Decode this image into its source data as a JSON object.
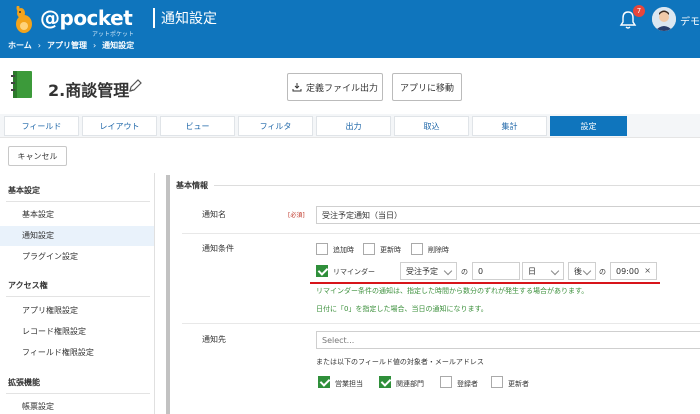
{
  "header": {
    "brand": "@pocket",
    "brand_sub": "アットポケット",
    "page_title": "通知設定",
    "breadcrumbs": [
      "ホーム",
      "アプリ管理",
      "通知設定"
    ],
    "breadcrumb_sep": "›",
    "notification_count": "7",
    "user_name": "デモ"
  },
  "app": {
    "title": "2.商談管理",
    "export_label": "定義ファイル出力",
    "goto_label": "アプリに移動"
  },
  "tabs": [
    "フィールド",
    "レイアウト",
    "ビュー",
    "フィルタ",
    "出力",
    "取込",
    "集計",
    "設定"
  ],
  "active_tab": "設定",
  "cancel_label": "キャンセル",
  "sidebar": {
    "sections": [
      {
        "title": "基本設定",
        "items": [
          "基本設定",
          "通知設定",
          "プラグイン設定"
        ]
      },
      {
        "title": "アクセス権",
        "items": [
          "アプリ権限設定",
          "レコード権限設定",
          "フィールド権限設定"
        ]
      },
      {
        "title": "拡張機能",
        "items": [
          "帳票設定"
        ]
      }
    ],
    "active_item": "通知設定"
  },
  "form": {
    "section_title": "基本情報",
    "name_label": "通知名",
    "required_label": "[必須]",
    "name_value": "受注予定通知（当日）",
    "condition_label": "通知条件",
    "condition_options": [
      {
        "label": "追加時",
        "checked": false
      },
      {
        "label": "更新時",
        "checked": false
      },
      {
        "label": "削除時",
        "checked": false
      }
    ],
    "reminder": {
      "label": "リマインダー",
      "checked": true,
      "field": "受注予定",
      "of1": "の",
      "offset_value": "0",
      "unit": "日",
      "direction": "後",
      "of2": "の",
      "time": "09:00",
      "clear": "×"
    },
    "note_red": "リマインダー条件の通知は、指定した時間から数分のずれが発生する場合があります。",
    "note_green": "日付に「0」を指定した場合、当日の通知になります。",
    "recipient_label": "通知先",
    "recipient_placeholder": "Select...",
    "recipient_help": "または以下のフィールド値の対象者・メールアドレス",
    "recipient_fields": [
      {
        "label": "営業担当",
        "checked": true
      },
      {
        "label": "関連部門",
        "checked": true
      },
      {
        "label": "登録者",
        "checked": false
      },
      {
        "label": "更新者",
        "checked": false
      }
    ]
  },
  "colors": {
    "header_bg": "#0f75bd",
    "active_tab": "#0f75bd",
    "checkbox_on": "#2f8f3a",
    "required": "#c0392b",
    "note_red": "#d7141a",
    "note_green": "#3a8f3a"
  }
}
